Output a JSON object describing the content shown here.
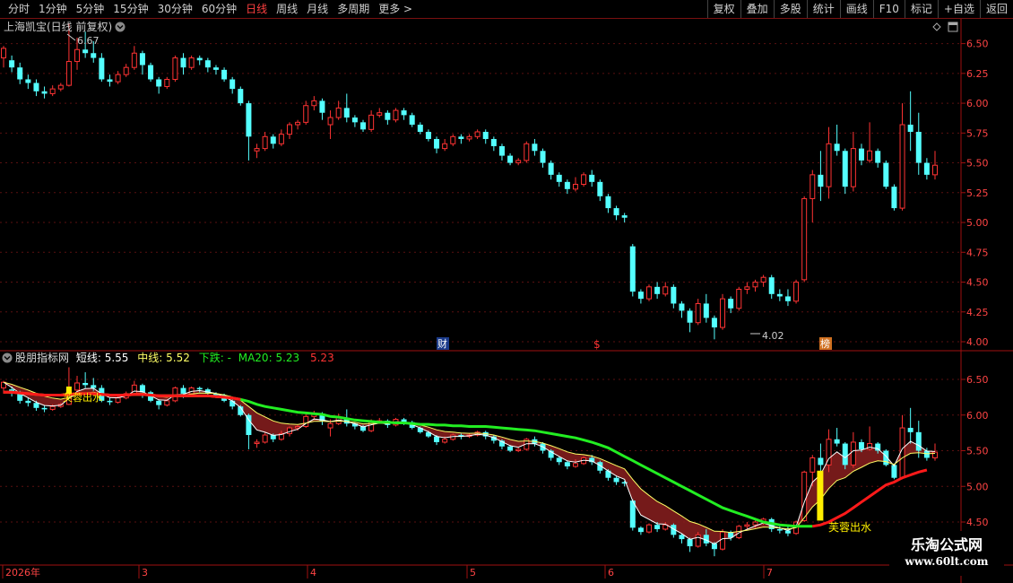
{
  "toolbar": {
    "periods": [
      "分时",
      "1分钟",
      "5分钟",
      "15分钟",
      "30分钟",
      "60分钟",
      "日线",
      "周线",
      "月线",
      "多周期",
      "更多 >"
    ],
    "active_period": "日线",
    "actions": [
      "复权",
      "叠加",
      "多股",
      "统计",
      "画线",
      "F10",
      "标记",
      "+自选",
      "返回"
    ]
  },
  "main_panel": {
    "title": "上海凯宝(日线 前复权)",
    "high_marker": "6.67",
    "low_marker": "4.02",
    "price_axis": [
      "6.50",
      "6.25",
      "6.00",
      "5.75",
      "5.50",
      "5.25",
      "5.00",
      "4.75",
      "4.50",
      "4.25",
      "4.00"
    ],
    "event_labels": [
      "财",
      "$",
      "榜"
    ]
  },
  "indicator_panel": {
    "name": "股朋指标网",
    "short_label": "短线:",
    "short_value": "5.55",
    "mid_label": "中线:",
    "mid_value": "5.52",
    "down_label": "下跌:",
    "down_value": "-",
    "ma20_label": "MA20:",
    "ma20_value": "5.23",
    "red_value": "5.23",
    "price_axis": [
      "6.50",
      "6.00",
      "5.50",
      "5.00",
      "4.50"
    ],
    "signal_text": "芙蓉出水"
  },
  "date_axis": [
    "2026年",
    "3",
    "4",
    "5",
    "6",
    "7"
  ],
  "watermark": {
    "line1": "乐淘公式网",
    "line2": "www.60lt.com"
  },
  "colors": {
    "up": "#ff3333",
    "down": "#54ffff",
    "green_line": "#22ee22",
    "red_line": "#ff1a1a",
    "signal": "#ffee00",
    "frame": "#a01010"
  },
  "chart_data": {
    "type": "candlestick",
    "ylim": [
      4.0,
      6.67
    ],
    "candles": [
      [
        6.38,
        6.46,
        6.3,
        6.48
      ],
      [
        6.36,
        6.3,
        6.26,
        6.4
      ],
      [
        6.3,
        6.2,
        6.16,
        6.34
      ],
      [
        6.2,
        6.17,
        6.12,
        6.24
      ],
      [
        6.17,
        6.1,
        6.06,
        6.2
      ],
      [
        6.1,
        6.08,
        6.04,
        6.14
      ],
      [
        6.08,
        6.12,
        6.06,
        6.15
      ],
      [
        6.12,
        6.15,
        6.1,
        6.17
      ],
      [
        6.15,
        6.35,
        6.14,
        6.67
      ],
      [
        6.35,
        6.45,
        6.28,
        6.55
      ],
      [
        6.45,
        6.42,
        6.38,
        6.6
      ],
      [
        6.42,
        6.38,
        6.34,
        6.52
      ],
      [
        6.38,
        6.2,
        6.18,
        6.42
      ],
      [
        6.2,
        6.18,
        6.14,
        6.24
      ],
      [
        6.18,
        6.24,
        6.16,
        6.27
      ],
      [
        6.24,
        6.3,
        6.22,
        6.33
      ],
      [
        6.3,
        6.42,
        6.28,
        6.48
      ],
      [
        6.42,
        6.32,
        6.24,
        6.44
      ],
      [
        6.32,
        6.2,
        6.18,
        6.34
      ],
      [
        6.2,
        6.14,
        6.08,
        6.22
      ],
      [
        6.14,
        6.2,
        6.12,
        6.22
      ],
      [
        6.2,
        6.38,
        6.18,
        6.4
      ],
      [
        6.38,
        6.3,
        6.24,
        6.42
      ],
      [
        6.3,
        6.38,
        6.28,
        6.4
      ],
      [
        6.38,
        6.36,
        6.32,
        6.4
      ],
      [
        6.36,
        6.3,
        6.26,
        6.38
      ],
      [
        6.3,
        6.28,
        6.24,
        6.32
      ],
      [
        6.28,
        6.2,
        6.18,
        6.3
      ],
      [
        6.2,
        6.12,
        6.08,
        6.22
      ],
      [
        6.12,
        6.0,
        5.98,
        6.14
      ],
      [
        6.0,
        5.72,
        5.52,
        6.02
      ],
      [
        5.6,
        5.62,
        5.54,
        5.66
      ],
      [
        5.62,
        5.72,
        5.6,
        5.76
      ],
      [
        5.72,
        5.66,
        5.62,
        5.74
      ],
      [
        5.66,
        5.74,
        5.64,
        5.78
      ],
      [
        5.74,
        5.82,
        5.7,
        5.84
      ],
      [
        5.82,
        5.84,
        5.78,
        5.86
      ],
      [
        5.84,
        5.98,
        5.82,
        6.02
      ],
      [
        5.98,
        6.02,
        5.94,
        6.06
      ],
      [
        6.02,
        5.92,
        5.86,
        6.04
      ],
      [
        5.82,
        5.88,
        5.7,
        5.94
      ],
      [
        5.88,
        5.96,
        5.86,
        6.02
      ],
      [
        5.96,
        5.88,
        5.84,
        6.08
      ],
      [
        5.88,
        5.84,
        5.8,
        5.9
      ],
      [
        5.84,
        5.78,
        5.76,
        5.86
      ],
      [
        5.78,
        5.9,
        5.76,
        5.94
      ],
      [
        5.9,
        5.92,
        5.88,
        5.96
      ],
      [
        5.92,
        5.86,
        5.82,
        5.94
      ],
      [
        5.86,
        5.94,
        5.84,
        5.96
      ],
      [
        5.94,
        5.9,
        5.86,
        5.96
      ],
      [
        5.9,
        5.82,
        5.8,
        5.92
      ],
      [
        5.82,
        5.76,
        5.74,
        5.84
      ],
      [
        5.76,
        5.7,
        5.68,
        5.78
      ],
      [
        5.7,
        5.62,
        5.58,
        5.72
      ],
      [
        5.62,
        5.66,
        5.6,
        5.7
      ],
      [
        5.66,
        5.72,
        5.64,
        5.74
      ],
      [
        5.72,
        5.7,
        5.66,
        5.74
      ],
      [
        5.7,
        5.72,
        5.68,
        5.74
      ],
      [
        5.72,
        5.76,
        5.7,
        5.78
      ],
      [
        5.76,
        5.7,
        5.66,
        5.78
      ],
      [
        5.7,
        5.64,
        5.6,
        5.72
      ],
      [
        5.64,
        5.56,
        5.52,
        5.66
      ],
      [
        5.56,
        5.5,
        5.48,
        5.58
      ],
      [
        5.5,
        5.52,
        5.48,
        5.54
      ],
      [
        5.52,
        5.66,
        5.5,
        5.68
      ],
      [
        5.66,
        5.6,
        5.56,
        5.7
      ],
      [
        5.6,
        5.5,
        5.46,
        5.62
      ],
      [
        5.5,
        5.4,
        5.36,
        5.52
      ],
      [
        5.4,
        5.34,
        5.3,
        5.42
      ],
      [
        5.34,
        5.28,
        5.24,
        5.36
      ],
      [
        5.28,
        5.32,
        5.26,
        5.38
      ],
      [
        5.32,
        5.4,
        5.3,
        5.42
      ],
      [
        5.4,
        5.34,
        5.3,
        5.44
      ],
      [
        5.34,
        5.22,
        5.18,
        5.36
      ],
      [
        5.22,
        5.12,
        5.08,
        5.24
      ],
      [
        5.12,
        5.06,
        5.02,
        5.14
      ],
      [
        5.06,
        5.04,
        5.0,
        5.08
      ],
      [
        4.8,
        4.42,
        4.38,
        4.82
      ],
      [
        4.42,
        4.36,
        4.32,
        4.44
      ],
      [
        4.36,
        4.46,
        4.34,
        4.48
      ],
      [
        4.46,
        4.4,
        4.36,
        4.5
      ],
      [
        4.4,
        4.46,
        4.38,
        4.5
      ],
      [
        4.46,
        4.32,
        4.28,
        4.48
      ],
      [
        4.32,
        4.26,
        4.2,
        4.34
      ],
      [
        4.26,
        4.16,
        4.08,
        4.28
      ],
      [
        4.16,
        4.32,
        4.14,
        4.36
      ],
      [
        4.32,
        4.2,
        4.16,
        4.4
      ],
      [
        4.2,
        4.12,
        4.02,
        4.22
      ],
      [
        4.12,
        4.36,
        4.1,
        4.4
      ],
      [
        4.36,
        4.28,
        4.24,
        4.38
      ],
      [
        4.28,
        4.44,
        4.26,
        4.46
      ],
      [
        4.44,
        4.46,
        4.4,
        4.5
      ],
      [
        4.46,
        4.5,
        4.42,
        4.52
      ],
      [
        4.5,
        4.54,
        4.46,
        4.56
      ],
      [
        4.54,
        4.4,
        4.36,
        4.56
      ],
      [
        4.4,
        4.38,
        4.34,
        4.44
      ],
      [
        4.38,
        4.34,
        4.3,
        4.44
      ],
      [
        4.34,
        4.5,
        4.32,
        4.52
      ],
      [
        4.52,
        5.2,
        4.5,
        5.22
      ],
      [
        5.2,
        5.4,
        5.0,
        5.44
      ],
      [
        5.4,
        5.3,
        5.18,
        5.6
      ],
      [
        5.3,
        5.66,
        5.2,
        5.8
      ],
      [
        5.66,
        5.6,
        5.56,
        5.82
      ],
      [
        5.6,
        5.3,
        5.24,
        5.62
      ],
      [
        5.3,
        5.62,
        5.26,
        5.76
      ],
      [
        5.62,
        5.52,
        5.48,
        5.66
      ],
      [
        5.52,
        5.6,
        5.5,
        5.84
      ],
      [
        5.6,
        5.5,
        5.46,
        5.62
      ],
      [
        5.5,
        5.3,
        5.28,
        5.52
      ],
      [
        5.3,
        5.12,
        5.1,
        5.32
      ],
      [
        5.12,
        5.82,
        5.1,
        6.0
      ],
      [
        5.82,
        5.76,
        5.6,
        6.1
      ],
      [
        5.76,
        5.5,
        5.4,
        5.92
      ],
      [
        5.5,
        5.4,
        5.36,
        5.54
      ],
      [
        5.4,
        5.48,
        5.36,
        5.6
      ]
    ],
    "ma20": [
      6.32,
      6.32,
      6.31,
      6.3,
      6.29,
      6.28,
      6.28,
      6.28,
      6.29,
      6.3,
      6.3,
      6.3,
      6.29,
      6.28,
      6.28,
      6.28,
      6.29,
      6.29,
      6.28,
      6.27,
      6.27,
      6.27,
      6.27,
      6.27,
      6.27,
      6.27,
      6.26,
      6.25,
      6.24,
      6.22,
      6.19,
      6.15,
      6.12,
      6.1,
      6.08,
      6.06,
      6.04,
      6.03,
      6.02,
      6.01,
      5.98,
      5.97,
      5.95,
      5.93,
      5.92,
      5.91,
      5.9,
      5.9,
      5.89,
      5.89,
      5.88,
      5.87,
      5.87,
      5.86,
      5.86,
      5.85,
      5.85,
      5.84,
      5.84,
      5.84,
      5.83,
      5.82,
      5.81,
      5.8,
      5.79,
      5.78,
      5.76,
      5.74,
      5.72,
      5.7,
      5.68,
      5.65,
      5.62,
      5.58,
      5.54,
      5.48,
      5.42,
      5.36,
      5.3,
      5.24,
      5.18,
      5.12,
      5.06,
      5.0,
      4.94,
      4.88,
      4.82,
      4.76,
      4.7,
      4.66,
      4.62,
      4.58,
      4.54,
      4.5,
      4.48,
      4.46,
      4.45,
      4.44,
      4.44,
      4.44,
      4.46,
      4.5,
      4.56,
      4.62,
      4.7,
      4.78,
      4.86,
      4.94,
      5.02,
      5.06,
      5.12,
      5.16,
      5.2,
      5.23
    ]
  }
}
